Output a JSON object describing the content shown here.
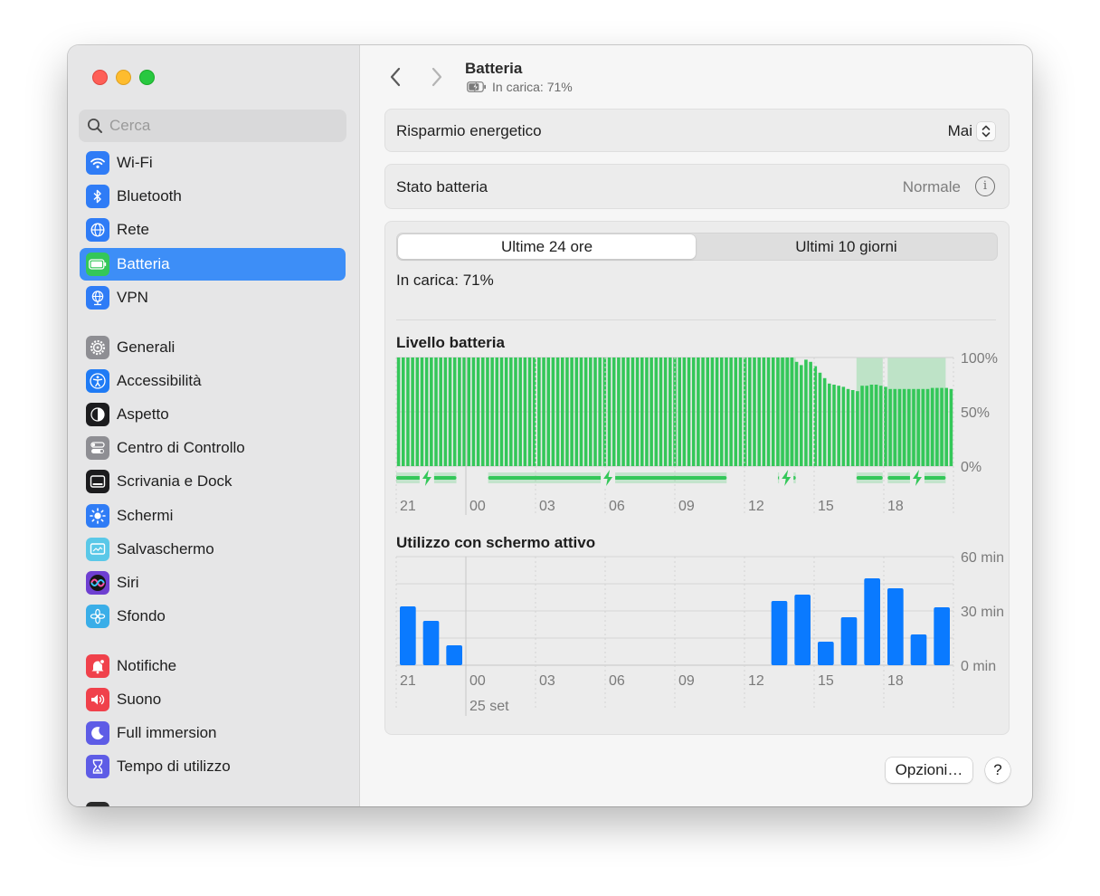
{
  "sidebar": {
    "search_placeholder": "Cerca",
    "items": [
      {
        "label": "Wi-Fi",
        "icon": "wifi-icon",
        "color": "#2f7cf6"
      },
      {
        "label": "Bluetooth",
        "icon": "bluetooth-icon",
        "color": "#2f7cf6"
      },
      {
        "label": "Rete",
        "icon": "globe-icon",
        "color": "#2f7cf6"
      },
      {
        "label": "Batteria",
        "icon": "battery-icon",
        "color": "#34c759",
        "active": true
      },
      {
        "label": "VPN",
        "icon": "vpn-globe-icon",
        "color": "#2f7cf6"
      },
      {
        "label": "Generali",
        "icon": "gear-icon",
        "color": "#8e8e93"
      },
      {
        "label": "Accessibilità",
        "icon": "accessibility-icon",
        "color": "#1f7bf5"
      },
      {
        "label": "Aspetto",
        "icon": "appearance-icon",
        "color": "#1c1c1e"
      },
      {
        "label": "Centro di Controllo",
        "icon": "control-center-icon",
        "color": "#8e8e93"
      },
      {
        "label": "Scrivania e Dock",
        "icon": "dock-icon",
        "color": "#1c1c1e"
      },
      {
        "label": "Schermi",
        "icon": "sun-icon",
        "color": "#2f7cf6"
      },
      {
        "label": "Salvaschermo",
        "icon": "screensaver-icon",
        "color": "#5ac8e8"
      },
      {
        "label": "Siri",
        "icon": "siri-icon",
        "color": "#6e3fd1"
      },
      {
        "label": "Sfondo",
        "icon": "flower-icon",
        "color": "#3aaee8"
      },
      {
        "label": "Notifiche",
        "icon": "bell-icon",
        "color": "#f0414b"
      },
      {
        "label": "Suono",
        "icon": "speaker-icon",
        "color": "#f0414b"
      },
      {
        "label": "Full immersion",
        "icon": "moon-icon",
        "color": "#5e5ce6"
      },
      {
        "label": "Tempo di utilizzo",
        "icon": "hourglass-icon",
        "color": "#5e5ce6"
      }
    ]
  },
  "header": {
    "title": "Batteria",
    "subtitle": "In carica: 71%"
  },
  "settings": {
    "energy_saver_label": "Risparmio energetico",
    "energy_saver_value": "Mai",
    "health_label": "Stato batteria",
    "health_value": "Normale"
  },
  "tabs": [
    {
      "label": "Ultime 24 ore",
      "selected": true
    },
    {
      "label": "Ultimi 10 giorni",
      "selected": false
    }
  ],
  "charge_status": "In carica: 71%",
  "buttons": {
    "options": "Opzioni…",
    "help": "?"
  },
  "colors": {
    "accent": "#3d8ef7",
    "battery_green": "#34c759",
    "usage_blue": "#0a7aff"
  },
  "chart_data": [
    {
      "type": "bar",
      "title": "Livello batteria",
      "x_ticks": [
        "21",
        "00",
        "03",
        "06",
        "09",
        "12",
        "15",
        "18"
      ],
      "y_ticks": [
        "100%",
        "50%",
        "0%"
      ],
      "ylim": [
        0,
        100
      ],
      "values": [
        100,
        100,
        100,
        100,
        100,
        100,
        100,
        100,
        100,
        100,
        100,
        100,
        100,
        100,
        100,
        100,
        100,
        100,
        100,
        100,
        100,
        100,
        100,
        100,
        100,
        100,
        100,
        100,
        100,
        100,
        100,
        100,
        100,
        100,
        100,
        100,
        100,
        100,
        100,
        100,
        100,
        100,
        100,
        100,
        100,
        100,
        100,
        100,
        100,
        100,
        100,
        100,
        100,
        100,
        100,
        100,
        100,
        100,
        100,
        100,
        100,
        100,
        100,
        100,
        100,
        100,
        100,
        100,
        100,
        100,
        100,
        100,
        100,
        100,
        100,
        100,
        100,
        100,
        100,
        100,
        100,
        100,
        100,
        100,
        100,
        96,
        93,
        98,
        96,
        92,
        86,
        81,
        76,
        75,
        74,
        73,
        71,
        70,
        69,
        74,
        74,
        75,
        75,
        74,
        73,
        71,
        71,
        71,
        71,
        71,
        71,
        71,
        71,
        71,
        72,
        72,
        72,
        72,
        71
      ],
      "charging_segments": [
        [
          0,
          0.108
        ],
        [
          0.165,
          0.593
        ],
        [
          0.685,
          0.717
        ],
        [
          0.826,
          0.873
        ],
        [
          0.882,
          0.986
        ]
      ],
      "charging_bolts": [
        0.055,
        0.38,
        0.7,
        0.935
      ],
      "shaded_segments": [
        [
          0.685,
          0.717
        ],
        [
          0.826,
          0.873
        ],
        [
          0.882,
          0.986
        ]
      ],
      "bar_color": "#34c759"
    },
    {
      "type": "bar",
      "title": "Utilizzo con schermo attivo",
      "x_ticks": [
        "21",
        "00",
        "03",
        "06",
        "09",
        "12",
        "15",
        "18"
      ],
      "x_sublabel": "25 set",
      "y_ticks": [
        "60 min",
        "30 min",
        "0 min"
      ],
      "ylim": [
        0,
        60
      ],
      "unit": "min",
      "values": [
        32.5,
        24.5,
        11,
        0,
        0,
        0,
        0,
        0,
        0,
        0,
        0,
        0,
        0,
        0,
        0,
        0,
        35.5,
        39,
        13,
        26.5,
        48,
        42.5,
        17,
        32
      ],
      "bar_color": "#0a7aff"
    }
  ]
}
